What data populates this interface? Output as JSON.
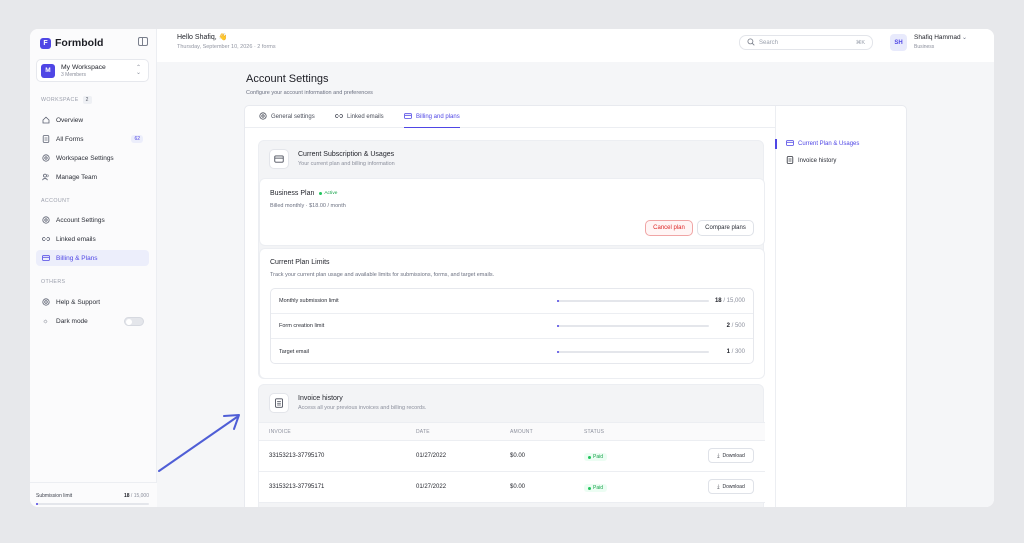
{
  "brand": {
    "name": "Formbold"
  },
  "workspace": {
    "initial": "M",
    "name": "My Workspace",
    "members": "3 Members"
  },
  "sidebar": {
    "workspace_label": "WORKSPACE",
    "workspace_count": "2",
    "workspace_items": [
      {
        "label": "Overview",
        "icon": "home-icon"
      },
      {
        "label": "All Forms",
        "icon": "forms-icon",
        "badge": "62"
      },
      {
        "label": "Workspace Settings",
        "icon": "gear-icon"
      },
      {
        "label": "Manage Team",
        "icon": "team-icon"
      }
    ],
    "account_label": "ACCOUNT",
    "account_items": [
      {
        "label": "Account Settings",
        "icon": "gear-icon"
      },
      {
        "label": "Linked emails",
        "icon": "link-icon"
      },
      {
        "label": "Billing & Plans",
        "icon": "card-icon",
        "active": true
      }
    ],
    "others_label": "OTHERS",
    "others_items": [
      {
        "label": "Help & Support",
        "icon": "help-icon"
      },
      {
        "label": "Dark mode",
        "icon": "sun-icon",
        "toggle": false
      }
    ],
    "submission_limit": {
      "label": "Submission limit",
      "used": "18",
      "total": "/ 15,000",
      "fraction": 0.0012
    }
  },
  "header": {
    "greeting": "Hello Shafiq, 👋",
    "subline": "Thursday, September 10, 2026 · 2 forms",
    "search_placeholder": "Search",
    "search_shortcut": "⌘K",
    "user_initials": "SH",
    "user_name": "Shafiq Hammad",
    "user_role": "Business"
  },
  "page": {
    "title": "Account Settings",
    "subtitle": "Configure your account information and preferences",
    "tabs": [
      {
        "label": "General settings",
        "icon": "gear-icon"
      },
      {
        "label": "Linked emails",
        "icon": "link-icon"
      },
      {
        "label": "Billing and plans",
        "icon": "card-icon",
        "active": true
      }
    ],
    "rail": [
      {
        "label": "Current Plan & Usages",
        "active": true
      },
      {
        "label": "Invoice history"
      }
    ]
  },
  "subscription": {
    "title": "Current Subscription & Usages",
    "subtitle": "Your current plan and billing information",
    "plan_name": "Business Plan",
    "plan_status": "Active",
    "plan_billing": "Billed monthly · $18.00 / month",
    "cancel_label": "Cancel plan",
    "compare_label": "Compare plans"
  },
  "limits": {
    "title": "Current Plan Limits",
    "subtitle": "Track your current plan usage and available limits for submissions, forms, and target emails.",
    "rows": [
      {
        "label": "Monthly submission limit",
        "used": "18",
        "total": "/ 15,000",
        "fraction": 0.0012
      },
      {
        "label": "Form creation limit",
        "used": "2",
        "total": "/ 500",
        "fraction": 0.004
      },
      {
        "label": "Target email",
        "used": "1",
        "total": "/ 300",
        "fraction": 0.0033
      }
    ]
  },
  "invoices": {
    "title": "Invoice history",
    "subtitle": "Access all your previous invoices and billing records.",
    "headers": [
      "INVOICE",
      "DATE",
      "AMOUNT",
      "STATUS"
    ],
    "download_label": "Download",
    "rows": [
      {
        "invoice": "33153213-37795170",
        "date": "01/27/2022",
        "amount": "$0.00",
        "status": "Paid"
      },
      {
        "invoice": "33153213-37795171",
        "date": "01/27/2022",
        "amount": "$0.00",
        "status": "Paid"
      }
    ]
  },
  "colors": {
    "accent": "#4f46e5",
    "danger": "#dc2626",
    "success": "#16a34a",
    "annotation_arrow": "#4f5ed6"
  }
}
